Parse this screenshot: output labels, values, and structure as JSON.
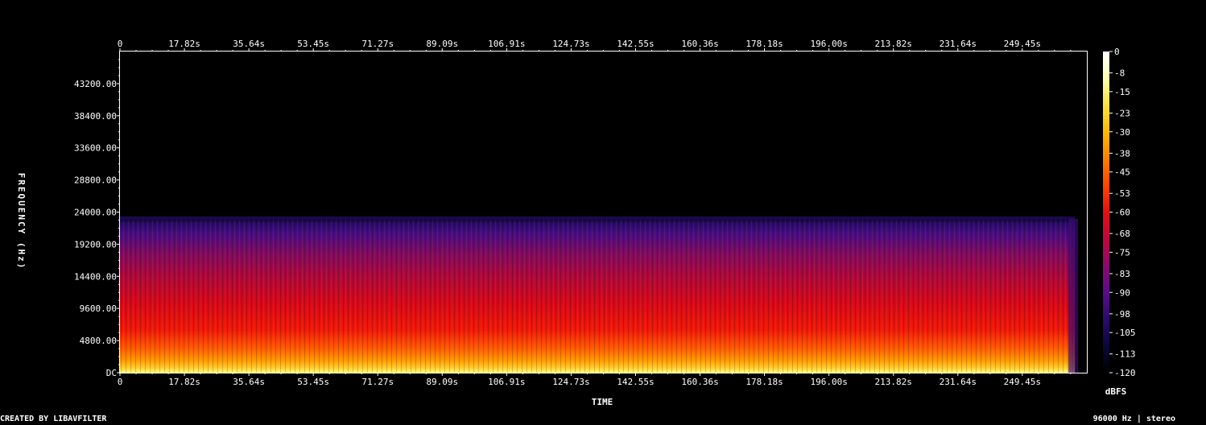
{
  "footer": {
    "left": "CREATED BY LIBAVFILTER",
    "right": "96000 Hz | stereo"
  },
  "chart_data": {
    "type": "heatmap",
    "xlabel": "TIME",
    "ylabel": "FREQUENCY (Hz)",
    "colorbar_label": "dBFS",
    "x_tick_labels": [
      "0",
      "17.82s",
      "35.64s",
      "53.45s",
      "71.27s",
      "89.09s",
      "106.91s",
      "124.73s",
      "142.55s",
      "160.36s",
      "178.18s",
      "196.00s",
      "213.82s",
      "231.64s",
      "249.45s"
    ],
    "x_ticks": [
      0,
      17.82,
      35.64,
      53.45,
      71.27,
      89.09,
      106.91,
      124.73,
      142.55,
      160.36,
      178.18,
      196.0,
      213.82,
      231.64,
      249.45
    ],
    "xlim": [
      0,
      267.3
    ],
    "y_tick_labels": [
      "DC",
      "4800.00",
      "9600.00",
      "14400.00",
      "19200.00",
      "24000.00",
      "28800.00",
      "33600.00",
      "38400.00",
      "43200.00"
    ],
    "y_ticks": [
      0,
      4800,
      9600,
      14400,
      19200,
      24000,
      28800,
      33600,
      38400,
      43200
    ],
    "ylim": [
      0,
      48000
    ],
    "colorbar_ticks": [
      0,
      -8,
      -15,
      -23,
      -30,
      -38,
      -45,
      -53,
      -60,
      -68,
      -75,
      -83,
      -90,
      -98,
      -105,
      -113,
      -120
    ],
    "colorbar_range": [
      -120,
      0
    ],
    "signal_duration_s": 264.0,
    "signal_max_freq_hz": 23000,
    "colormap": [
      "#000000",
      "#0a0838",
      "#2c0a6e",
      "#5a0c8a",
      "#8a0a70",
      "#c0063c",
      "#e61010",
      "#ff4400",
      "#ff8000",
      "#ffb800",
      "#ffe040",
      "#ffffb0",
      "#ffffff"
    ]
  }
}
